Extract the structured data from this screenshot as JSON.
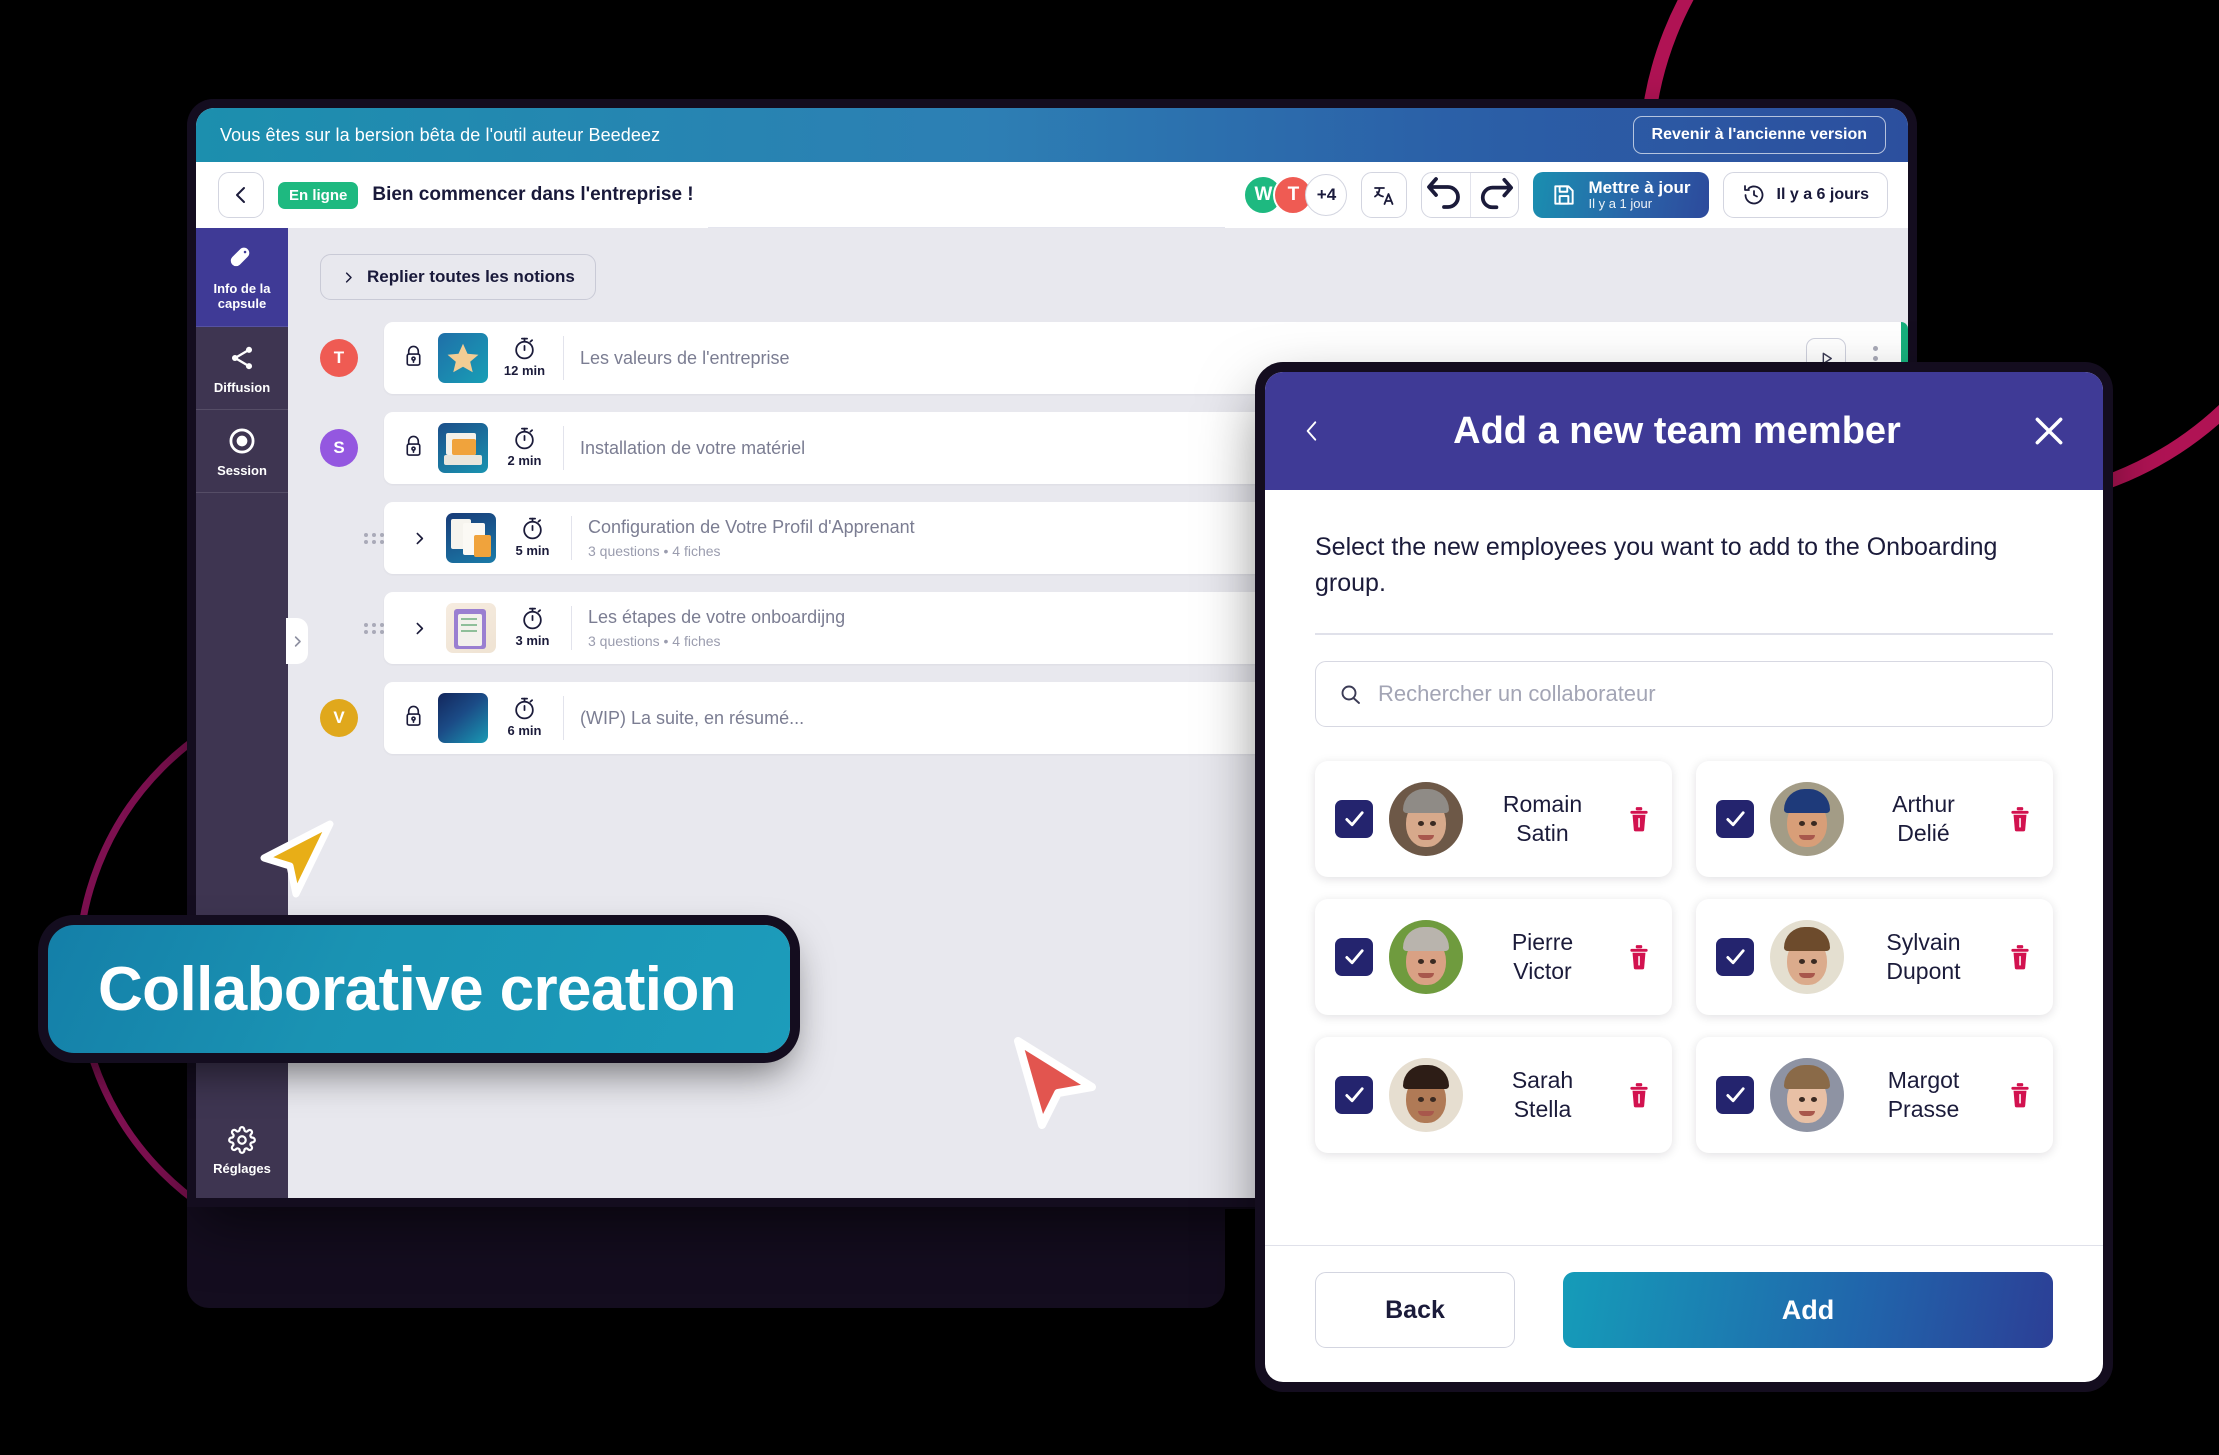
{
  "beta_banner": {
    "text": "Vous êtes sur la bersion bêta de l'outil auteur Beedeez",
    "revert_button": "Revenir à l'ancienne version"
  },
  "toolbar": {
    "back_icon": "chevron-left-icon",
    "status_badge": "En ligne",
    "doc_title": "Bien commencer dans l'entreprise !",
    "avatars": [
      {
        "initial": "W",
        "color": "#1eb980"
      },
      {
        "initial": "T",
        "color": "#ef5b53"
      }
    ],
    "avatar_more": "+4",
    "translate_icon": "translate-icon",
    "undo_icon": "undo-icon",
    "redo_icon": "redo-icon",
    "save": {
      "label": "Mettre à jour",
      "sublabel": "Il y a 1 jour",
      "icon": "save-disk-icon"
    },
    "history": {
      "label": "Il y a 6 jours",
      "icon": "history-clock-icon"
    }
  },
  "sidebar": {
    "items": [
      {
        "label": "Info de la capsule",
        "icon": "capsule-pill-icon",
        "active": true
      },
      {
        "label": "Diffusion",
        "icon": "share-nodes-icon",
        "active": false
      },
      {
        "label": "Session",
        "icon": "record-circle-icon",
        "active": false
      }
    ],
    "bottom_item": {
      "label": "Réglages",
      "icon": "gear-icon"
    },
    "expander_icon": "chevron-right-icon"
  },
  "content": {
    "collapse_all_button": "Replier toutes les notions",
    "collapse_icon": "chevron-right-icon",
    "rows": [
      {
        "avatar": "T",
        "avatar_color": "#ef5b53",
        "locked": true,
        "has_grip": false,
        "has_chevron": false,
        "thumb": "star-thumbnail",
        "duration": "12 min",
        "title": "Les valeurs de l'entreprise",
        "subtitle": "",
        "status_color": "#17b07c"
      },
      {
        "avatar": "S",
        "avatar_color": "#9457e0",
        "locked": true,
        "has_grip": false,
        "has_chevron": false,
        "thumb": "desktop-setup-thumbnail",
        "duration": "2 min",
        "title": "Installation de votre matériel",
        "subtitle": "",
        "status_color": "#e9a04a"
      },
      {
        "avatar": "",
        "avatar_color": "transparent",
        "locked": false,
        "has_grip": true,
        "has_chevron": true,
        "thumb": "documents-thumbnail",
        "duration": "5 min",
        "title": "Configuration de Votre Profil d'Apprenant",
        "subtitle": "3 questions  •  4 fiches",
        "status_color": "#d2124f"
      },
      {
        "avatar": "",
        "avatar_color": "transparent",
        "locked": false,
        "has_grip": true,
        "has_chevron": true,
        "thumb": "clipboard-thumbnail",
        "duration": "3 min",
        "title": "Les étapes de votre onboardijng",
        "subtitle": "3 questions  •  4 fiches",
        "status_color": "#d2124f"
      },
      {
        "avatar": "V",
        "avatar_color": "#e0a81c",
        "locked": true,
        "has_grip": false,
        "has_chevron": false,
        "thumb": "blank-gradient-thumbnail",
        "duration": "6 min",
        "title": "(WIP) La suite, en résumé...",
        "subtitle": "",
        "status_color": "#e9a04a"
      }
    ],
    "row_play_icon": "play-icon",
    "row_menu_icon": "kebab-menu-icon"
  },
  "label_pill": {
    "text": "Collaborative creation"
  },
  "modal": {
    "back_icon": "chevron-left-icon",
    "title": "Add a new team member",
    "close_icon": "close-x-icon",
    "description": "Select the new employees you want to add to the Onboarding group.",
    "search": {
      "placeholder": "Rechercher un collaborateur",
      "value": "",
      "icon": "search-icon"
    },
    "employees": [
      {
        "first": "Romain",
        "last": "Satin",
        "checked": true,
        "photo": "photo-romain-satin",
        "skin": "#d7a98b",
        "hair": "#8f8b86",
        "bg": "#6d5847",
        "delete_icon": "trash-icon"
      },
      {
        "first": "Arthur",
        "last": "Delié",
        "checked": true,
        "photo": "photo-arthur-delie",
        "skin": "#d89e78",
        "hair": "#1e3a7a",
        "bg": "#a39c86",
        "delete_icon": "trash-icon"
      },
      {
        "first": "Pierre",
        "last": "Victor",
        "checked": true,
        "photo": "photo-pierre-victor",
        "skin": "#d9a184",
        "hair": "#b9b4ad",
        "bg": "#6f9b3e",
        "delete_icon": "trash-icon"
      },
      {
        "first": "Sylvain",
        "last": "Dupont",
        "checked": true,
        "photo": "photo-sylvain-dupont",
        "skin": "#dbab8c",
        "hair": "#6d4b2c",
        "bg": "#e4dfd0",
        "delete_icon": "trash-icon"
      },
      {
        "first": "Sarah",
        "last": "Stella",
        "checked": true,
        "photo": "photo-sarah-stella",
        "skin": "#b07a56",
        "hair": "#2d1d16",
        "bg": "#e6ded0",
        "delete_icon": "trash-icon"
      },
      {
        "first": "Margot",
        "last": "Prasse",
        "checked": true,
        "photo": "photo-margot-prasse",
        "skin": "#e8c0a5",
        "hair": "#8a6a48",
        "bg": "#8e93a3",
        "delete_icon": "trash-icon"
      }
    ],
    "footer": {
      "back_button": "Back",
      "add_button": "Add"
    }
  },
  "cursors": [
    {
      "name": "yellow-pointer",
      "color": "#e8ae17"
    },
    {
      "name": "red-pointer",
      "color": "#e2554f"
    }
  ],
  "theme": {
    "banner_gradient_start": "#1c8fae",
    "banner_gradient_end": "#2c4f9e",
    "sidebar_bg": "#3e3551",
    "sidebar_active": "#3f3a96",
    "modal_header": "#3f3a96",
    "checkbox": "#24246e",
    "trash": "#d2124f",
    "content_bg": "#e8e8ee",
    "ring_outer": "#b01354",
    "ring_inner": "#7d1050"
  }
}
